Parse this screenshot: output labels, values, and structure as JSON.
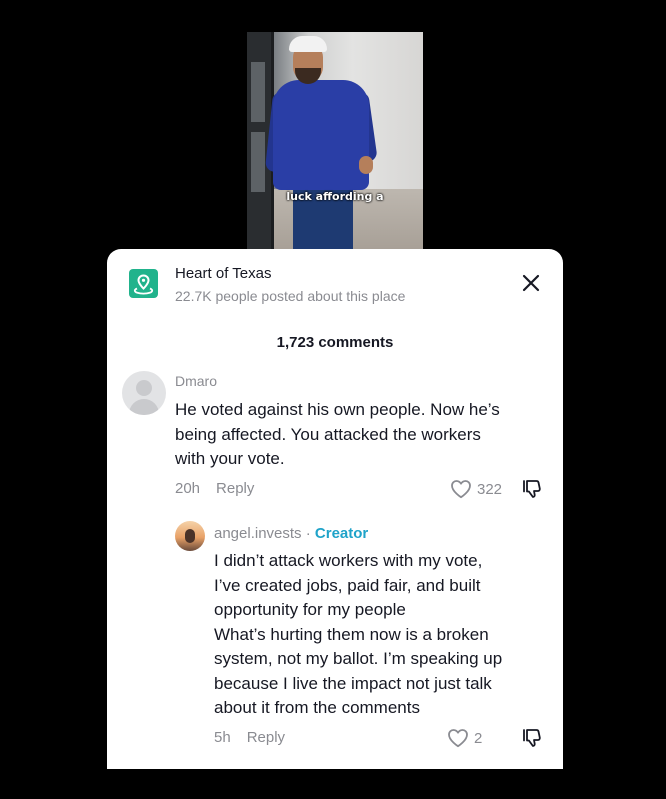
{
  "video": {
    "caption": "luck affording a"
  },
  "place": {
    "icon": "location-pin-icon",
    "name": "Heart of Texas",
    "subtitle": "22.7K people posted about this place",
    "accent": "#21b38c"
  },
  "comments_header": {
    "count_label": "1,723 comments"
  },
  "comments": [
    {
      "username": "Dmaro",
      "lines": [
        "He voted against his own people. Now he’s",
        "being affected. You attacked the workers",
        "with your vote."
      ],
      "time": "20h",
      "reply_label": "Reply",
      "likes": "322"
    }
  ],
  "reply": {
    "username": "angel.invests",
    "separator": " · ",
    "badge": "Creator",
    "badge_color": "#1fa3c9",
    "lines": [
      "I didn’t attack workers with my vote,",
      "I’ve created jobs, paid fair, and built",
      "opportunity for my people",
      "What’s hurting them now is a broken",
      "system, not my ballot. I’m speaking up",
      "because I live the impact not just talk",
      "about it from the comments"
    ],
    "time": "5h",
    "reply_label": "Reply",
    "likes": "2"
  }
}
